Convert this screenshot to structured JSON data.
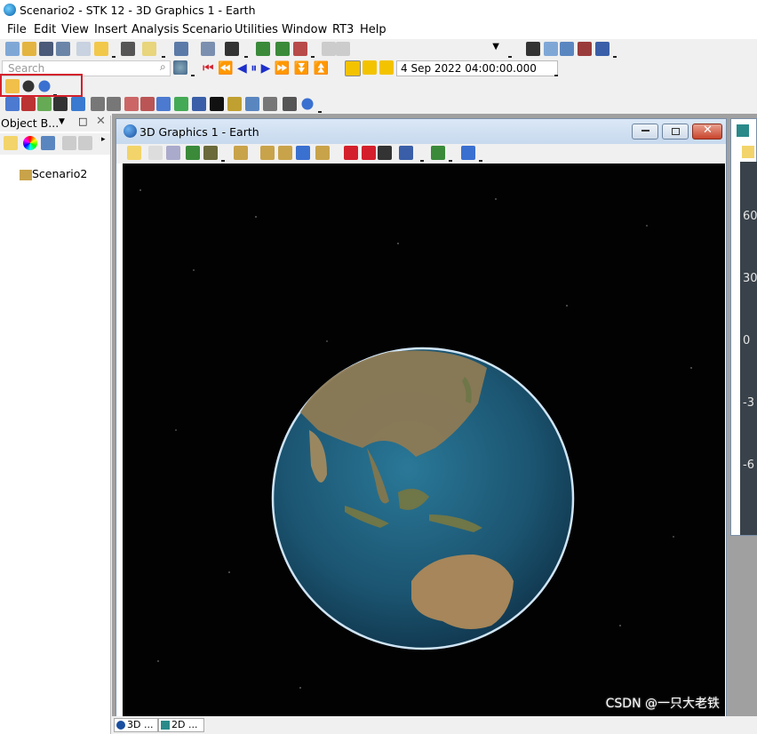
{
  "window": {
    "title": "Scenario2 - STK 12 - 3D Graphics 1 - Earth"
  },
  "menu": [
    "File",
    "Edit",
    "View",
    "Insert",
    "Analysis",
    "Scenario",
    "Utilities",
    "Window",
    "RT3",
    "Help"
  ],
  "search": {
    "placeholder": "Search"
  },
  "animation": {
    "current_time": "4 Sep 2022 04:00:00.000"
  },
  "object_browser": {
    "title": "Object B...",
    "tree": [
      "Scenario2"
    ]
  },
  "graphics_window": {
    "title": "3D Graphics 1 - Earth"
  },
  "map_window": {
    "axis_labels": [
      "60",
      "30",
      "0",
      "-3",
      "-6"
    ]
  },
  "tabs": [
    "3D ...",
    "2D ..."
  ],
  "watermark": "CSDN @一只大老铁",
  "colors": {
    "highlight": "#d4202c",
    "titlebar_gradient_top": "#dbe8f6",
    "ocean": "#1f5a7a"
  }
}
